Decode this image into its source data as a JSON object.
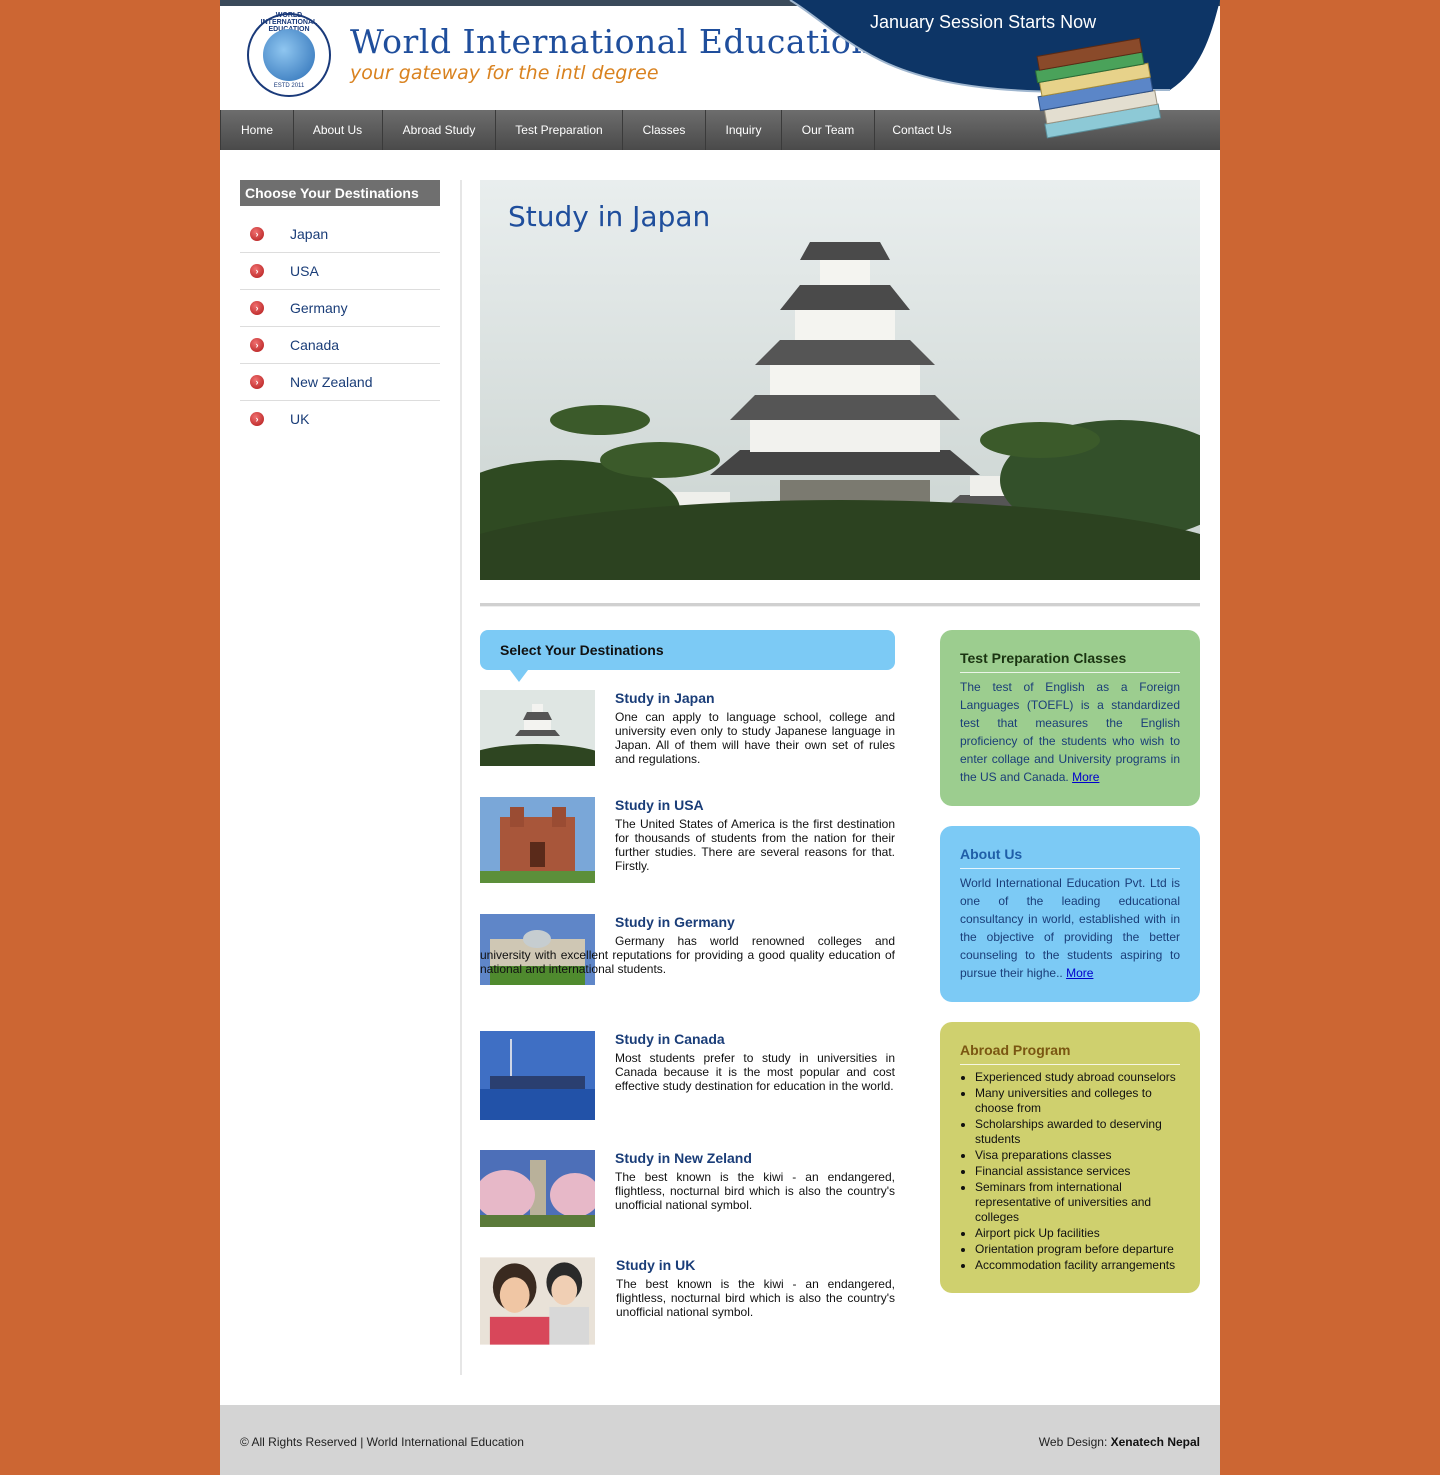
{
  "header": {
    "logo_text": "WORLD INTERNATIONAL EDUCATION",
    "logo_estd": "ESTD 2011",
    "brand": "World International Education",
    "tagline": "your gateway for the intl degree",
    "session": "January Session Starts Now"
  },
  "nav": [
    "Home",
    "About Us",
    "Abroad Study",
    "Test Preparation",
    "Classes",
    "Inquiry",
    "Our Team",
    "Contact Us"
  ],
  "sidebar": {
    "title": "Choose Your Destinations",
    "items": [
      "Japan",
      "USA",
      "Germany",
      "Canada",
      "New Zealand",
      "UK"
    ]
  },
  "hero": {
    "title": "Study in Japan"
  },
  "destinations": {
    "banner": "Select Your Destinations",
    "items": [
      {
        "title": "Study in Japan",
        "text": "One can apply to language school, college and university even only to study Japanese language in Japan. All of them will have their own set of rules and regulations."
      },
      {
        "title": "Study in USA",
        "text": "The United States of America is the first destination for thousands of students from the nation for their further studies. There are several reasons for that. Firstly."
      },
      {
        "title": "Study in Germany",
        "text": "Germany has world renowned colleges and university with excellent reputations for providing a good quality education of national and international students."
      },
      {
        "title": "Study in Canada",
        "text": "Most students prefer to study in universities in Canada because it is the most popular and cost effective study destination for education in the world."
      },
      {
        "title": "Study in New Zeland",
        "text": "The best known is the kiwi - an endangered, flightless, nocturnal bird which is also the country's unofficial national symbol."
      },
      {
        "title": "Study in UK",
        "text": "The best known is the kiwi - an endangered, flightless, nocturnal bird which is also the country's unofficial national symbol."
      }
    ]
  },
  "test_prep": {
    "title": "Test Preparation Classes",
    "text": "The test of English as a Foreign Languages (TOEFL) is a standardized test that measures the English proficiency of the students who wish to enter collage and University programs in the US and Canada.",
    "more": "More",
    "color": "#9ccd8f"
  },
  "about": {
    "title": "About Us",
    "text": "World International Education Pvt. Ltd is one of the leading educational consultancy in world, established with in the objective of providing the better counseling to the students aspiring to pursue their highe..",
    "more": "More",
    "color": "#7ccaf5"
  },
  "abroad": {
    "title": "Abroad Program",
    "color": "#cfd06e",
    "items": [
      "Experienced study abroad counselors",
      "Many universities and colleges to choose from",
      "Scholarships awarded to deserving students",
      "Visa preparations classes",
      "Financial assistance services",
      "Seminars from international representative of universities and colleges",
      "Airport pick Up facilities",
      "Orientation program before departure",
      "Accommodation facility arrangements"
    ]
  },
  "footer": {
    "copyright": "© All Rights Reserved | World International Education",
    "credit_label": "Web Design:",
    "credit_name": "Xenatech Nepal"
  }
}
